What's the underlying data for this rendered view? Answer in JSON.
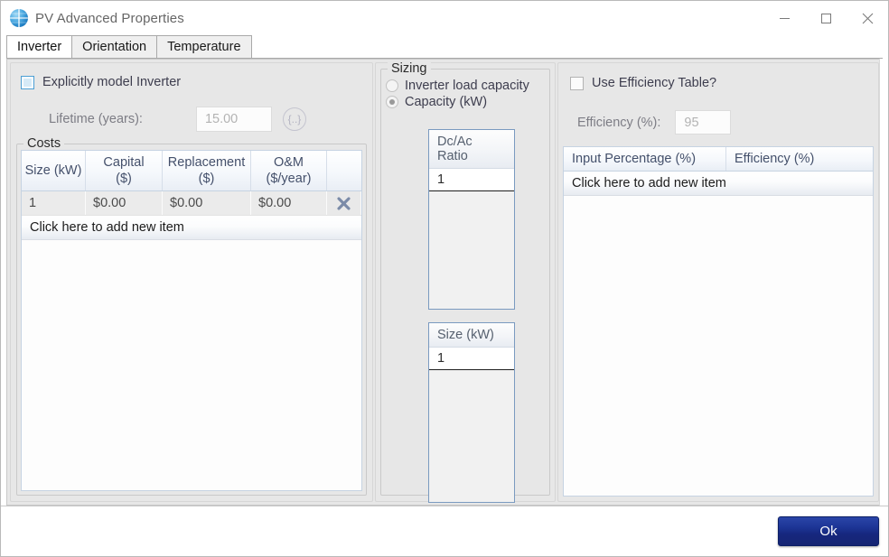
{
  "window": {
    "title": "PV Advanced Properties",
    "icon": "globe-icon",
    "minimize_label": "—",
    "maximize_label": "□",
    "close_label": "✕"
  },
  "tabs": [
    {
      "label": "Inverter",
      "active": true
    },
    {
      "label": "Orientation",
      "active": false
    },
    {
      "label": "Temperature",
      "active": false
    }
  ],
  "inverter": {
    "explicit_checkbox_label": "Explicitly model Inverter",
    "explicit_checked": false,
    "lifetime_label": "Lifetime (years):",
    "lifetime_value": "15.00",
    "ellipsis_button_label": "{..}",
    "costs_group_title": "Costs",
    "costs_columns": [
      "Size (kW)",
      "Capital\n($)",
      "Replacement\n($)",
      "O&M\n($/year)",
      ""
    ],
    "costs_columns_line1": [
      "Size (kW)",
      "Capital",
      "Replacement",
      "O&M",
      ""
    ],
    "costs_columns_line2": [
      "",
      "($)",
      "($)",
      "($/year)",
      ""
    ],
    "costs_rows": [
      {
        "size": "1",
        "capital": "$0.00",
        "replacement": "$0.00",
        "om": "$0.00",
        "delete_icon": "delete-x-icon"
      }
    ],
    "add_new_item_label": "Click here to add new item"
  },
  "sizing": {
    "group_title": "Sizing",
    "options": [
      {
        "label": "Inverter load capacity",
        "selected": false
      },
      {
        "label": "Capacity (kW)",
        "selected": true
      }
    ],
    "dcac_grid": {
      "header": "Dc/Ac Ratio",
      "rows": [
        "1"
      ]
    },
    "size_grid": {
      "header": "Size (kW)",
      "rows": [
        "1"
      ]
    }
  },
  "efficiency": {
    "use_table_checkbox_label": "Use Efficiency Table?",
    "use_table_checked": false,
    "efficiency_label": "Efficiency (%):",
    "efficiency_value": "95",
    "columns": [
      "Input Percentage (%)",
      "Efficiency (%)"
    ],
    "add_new_item_label": "Click here to add new item",
    "rows": []
  },
  "footer": {
    "ok_label": "Ok"
  },
  "colors": {
    "accent_blue": "#1c3494",
    "panel_bg": "#e7e7e7",
    "grid_header": "#eef2f8",
    "grid_border": "#c6d3e2",
    "title_text": "#666666"
  }
}
